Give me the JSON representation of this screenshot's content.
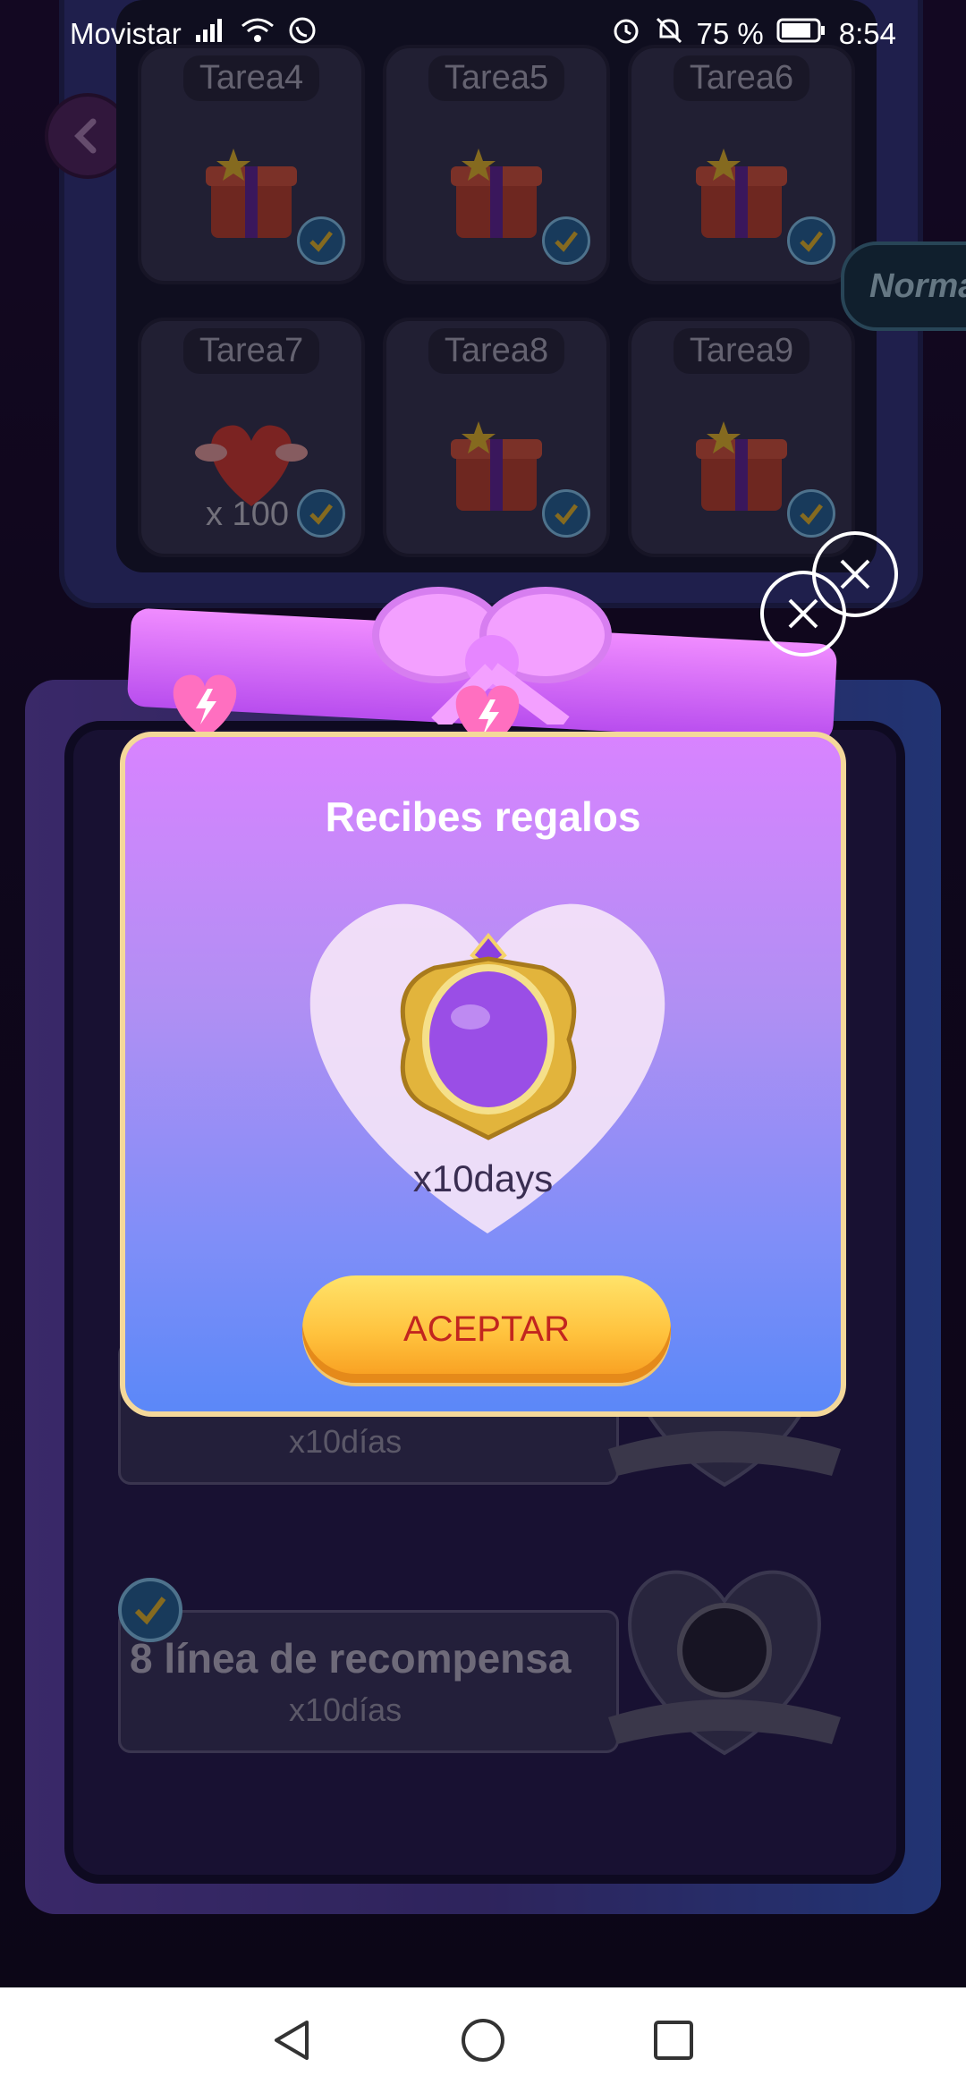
{
  "status_bar": {
    "carrier": "Movistar",
    "battery": "75 %",
    "time": "8:54",
    "icons": [
      "signal-icon",
      "wifi-icon",
      "whatsapp-icon",
      "alarm-icon",
      "mute-icon",
      "battery-icon"
    ]
  },
  "task_grid": {
    "tasks": [
      {
        "label": "Tarea4",
        "reward": "gift"
      },
      {
        "label": "Tarea5",
        "reward": "gift"
      },
      {
        "label": "Tarea6",
        "reward": "gift"
      },
      {
        "label": "Tarea7",
        "reward": "heart",
        "quantity": "x 100"
      },
      {
        "label": "Tarea8",
        "reward": "gift"
      },
      {
        "label": "Tarea9",
        "reward": "gift"
      }
    ]
  },
  "mode_tab": {
    "label": "Norma"
  },
  "reward_list": {
    "rows": [
      {
        "title": "",
        "subtitle": "x10días"
      },
      {
        "title": "8 línea de recompensa",
        "subtitle": "x10días"
      }
    ]
  },
  "modal": {
    "title": "Recibes regalos",
    "reward_amount": "x10days",
    "accept_label": "ACEPTAR"
  },
  "nav_bar": {
    "icons": [
      "back-triangle-icon",
      "home-circle-icon",
      "recents-square-icon"
    ]
  },
  "colors": {
    "modal_border": "#f4d89a",
    "accept_text": "#c2261f",
    "accept_button": "#ffc23d"
  }
}
